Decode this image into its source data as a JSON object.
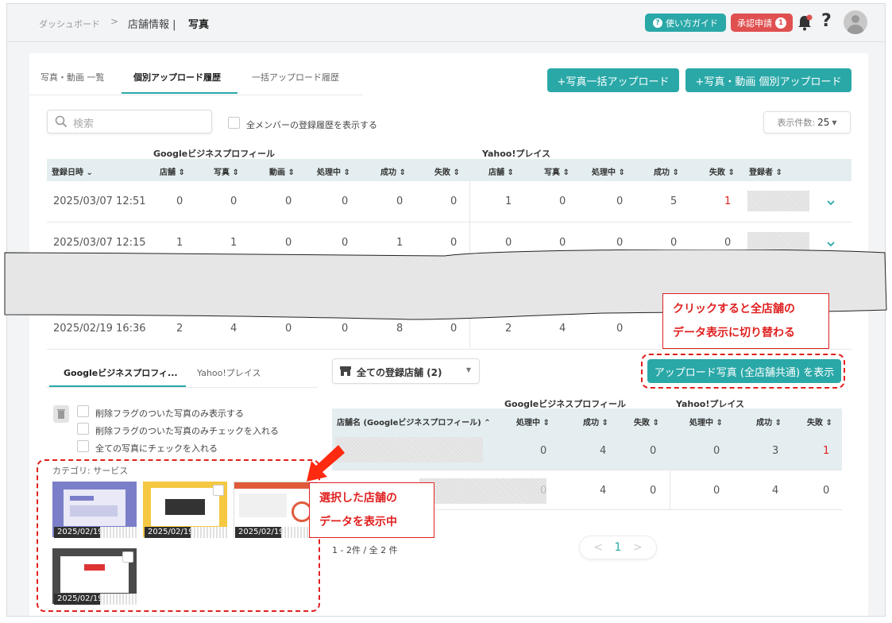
{
  "header": {
    "breadcrumb_home": "ダッシュボード",
    "breadcrumb_sep": ">",
    "breadcrumb_section": "店舗情報 |",
    "breadcrumb_current": "写真",
    "guide_label": "使い方ガイド",
    "approve_label": "承認申請",
    "approve_count": "1",
    "help_label": "?"
  },
  "tabs": [
    "写真・動画 一覧",
    "個別アップロード履歴",
    "一括アップロード履歴"
  ],
  "actions": {
    "bulk_upload": "+写真一括アップロード",
    "single_upload": "+写真・動画 個別アップロード"
  },
  "filters": {
    "search_placeholder": "検索",
    "show_all_members": "全メンバーの登録履歴を表示する",
    "per_page_label": "表示件数:",
    "per_page_value": "25"
  },
  "history_table": {
    "group_google": "Googleビジネスプロフィール",
    "group_yahoo": "Yahoo!プレイス",
    "col_date": "登録日時",
    "columns": [
      "店舗",
      "写真",
      "動画",
      "処理中",
      "成功",
      "失敗",
      "店舗",
      "写真",
      "処理中",
      "成功",
      "失敗",
      "登録者"
    ],
    "rows": [
      {
        "date": "2025/03/07 12:51",
        "values": [
          "0",
          "0",
          "0",
          "0",
          "0",
          "0",
          "1",
          "0",
          "0",
          "5",
          "1"
        ]
      },
      {
        "date": "2025/03/07 12:15",
        "values": [
          "1",
          "1",
          "0",
          "0",
          "1",
          "0",
          "0",
          "0",
          "0",
          "0",
          "0"
        ]
      },
      {
        "date": "2025/02/19 16:36",
        "values": [
          "2",
          "4",
          "0",
          "0",
          "8",
          "0",
          "2",
          "4",
          "0"
        ]
      }
    ]
  },
  "detail": {
    "tab_google": "Googleビジネスプロフィ...",
    "tab_yahoo": "Yahoo!プレイス",
    "opt_deleted_only": "削除フラグのついた写真のみ表示する",
    "opt_check_deleted": "削除フラグのついた写真のみチェックを入れる",
    "opt_check_all": "全ての写真にチェックを入れる",
    "category": "カテゴリ: サービス",
    "thumb_dates": [
      "2025/02/19",
      "2025/02/19",
      "2025/02/19",
      "2025/02/19"
    ],
    "store_select": "全ての登録店舗 (2)",
    "show_all_button": "アップロード写真 (全店舗共通) を表示",
    "group_google": "Googleビジネスプロフィール",
    "group_yahoo": "Yahoo!プレイス",
    "col_store": "店舗名 (Googleビジネスプロフィール)",
    "columns": [
      "処理中",
      "成功",
      "失敗",
      "処理中",
      "成功",
      "失敗"
    ],
    "rows": [
      {
        "values": [
          "0",
          "4",
          "0",
          "0",
          "3",
          "1"
        ]
      },
      {
        "values": [
          "0",
          "4",
          "0",
          "0",
          "4",
          "0"
        ]
      }
    ],
    "count_text": "1 - 2件 / 全 2 件",
    "page_prev": "<",
    "page_current": "1",
    "page_next": ">"
  },
  "annotations": {
    "note_toggle_line1": "クリックすると全店舗の",
    "note_toggle_line2": "データ表示に切り替わる",
    "note_selected_line1": "選択した店舗の",
    "note_selected_line2": "データを表示中"
  },
  "colors": {
    "accent": "#2aa8a8",
    "danger": "#e05050",
    "annotation": "#e02020",
    "header_row_bg": "#e4eef0"
  }
}
